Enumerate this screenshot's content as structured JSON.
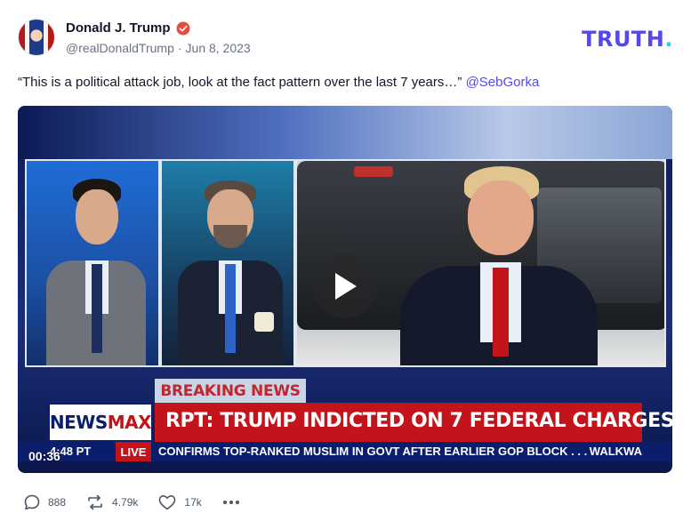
{
  "post": {
    "author_name": "Donald J. Trump",
    "handle": "@realDonaldTrump",
    "separator": "·",
    "date": "Jun 8, 2023",
    "text": "“This is a political attack job, look at the fact pattern over the last 7 years…”",
    "mention": "@SebGorka"
  },
  "brand": {
    "logo_text": "TRUTH",
    "logo_dot": "."
  },
  "video": {
    "duration": "00:36",
    "breaking_label": "BREAKING NEWS",
    "headline": "RPT: TRUMP INDICTED ON 7 FEDERAL CHARGES",
    "network": {
      "part1": "NEWS",
      "part2": "MAX"
    },
    "ticker_time": "4:48 PT",
    "ticker_live": "LIVE",
    "ticker_text": "CONFIRMS TOP-RANKED MUSLIM IN GOVT AFTER EARLIER GOP BLOCK . . .",
    "ticker_right": "WALKWA"
  },
  "actions": {
    "replies": "888",
    "retruths": "4.79k",
    "likes": "17k"
  },
  "colors": {
    "brand": "#5448ee",
    "mention": "#5448ee",
    "verified": "#e74c3c"
  },
  "icons": [
    "verified-badge-icon",
    "reply-icon",
    "retruth-icon",
    "like-icon",
    "more-icon",
    "play-icon"
  ]
}
